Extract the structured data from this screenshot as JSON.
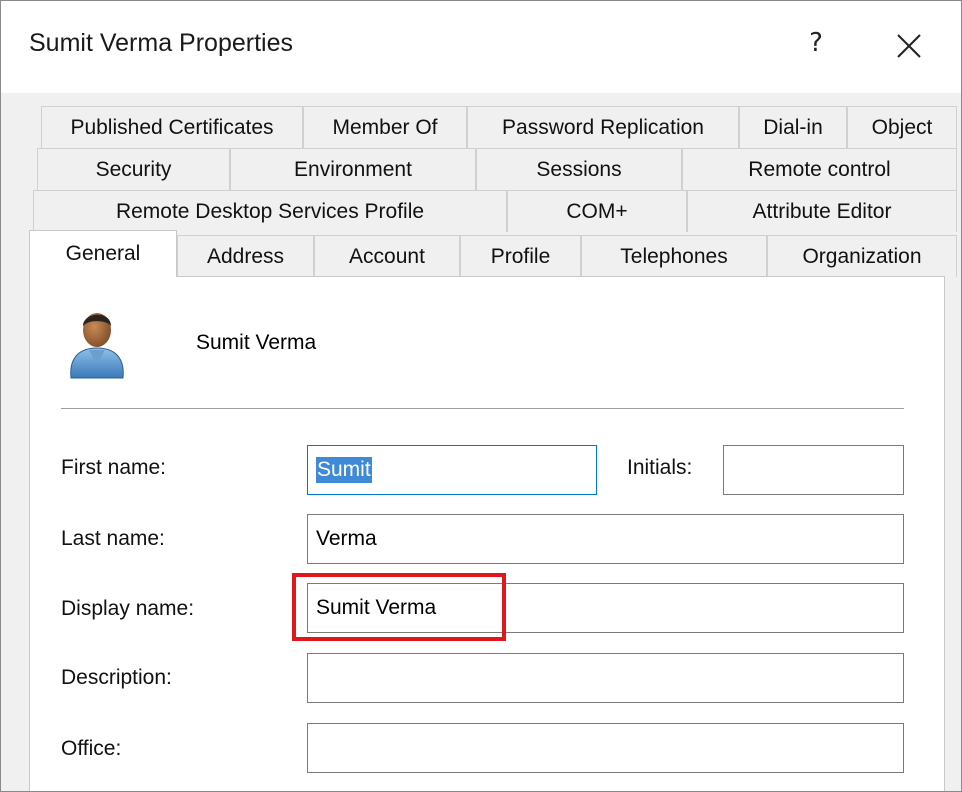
{
  "window": {
    "title": "Sumit Verma Properties",
    "help_label": "?"
  },
  "tabs": {
    "row1": [
      "Published Certificates",
      "Member Of",
      "Password Replication",
      "Dial-in",
      "Object"
    ],
    "row2": [
      "Security",
      "Environment",
      "Sessions",
      "Remote control"
    ],
    "row3": [
      "Remote Desktop Services Profile",
      "COM+",
      "Attribute Editor"
    ],
    "row4": [
      "General",
      "Address",
      "Account",
      "Profile",
      "Telephones",
      "Organization"
    ],
    "active": "General"
  },
  "general": {
    "user_display": "Sumit Verma",
    "avatar_icon": "user-icon",
    "fields": {
      "first_name_label": "First name:",
      "first_name_value": "Sumit",
      "initials_label": "Initials:",
      "initials_value": "",
      "last_name_label": "Last name:",
      "last_name_value": "Verma",
      "display_name_label": "Display name:",
      "display_name_value": "Sumit Verma",
      "description_label": "Description:",
      "description_value": "",
      "office_label": "Office:",
      "office_value": ""
    }
  },
  "colors": {
    "highlight_box": "#e0171d",
    "selection": "#3f8ad6",
    "focus_border": "#0078d7"
  }
}
